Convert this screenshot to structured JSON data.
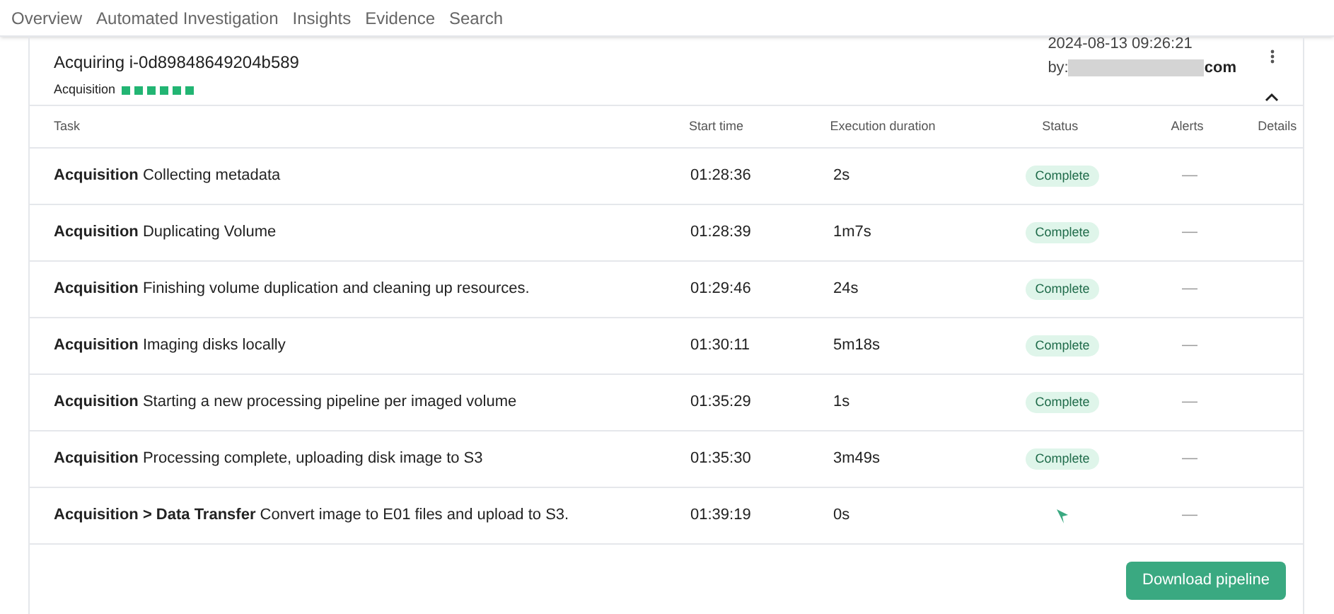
{
  "nav": {
    "tabs": [
      {
        "label": "Overview",
        "selected": false
      },
      {
        "label": "Automated Investigation",
        "selected": false
      },
      {
        "label": "Insights",
        "selected": false
      },
      {
        "label": "Evidence",
        "selected": false
      },
      {
        "label": "Search",
        "selected": false
      }
    ]
  },
  "header": {
    "title": "Acquiring i-0d89848649204b589",
    "stage": "Acquisition",
    "steps": [
      {
        "done": true
      },
      {
        "done": true
      },
      {
        "done": true
      },
      {
        "done": true
      },
      {
        "done": true
      },
      {
        "done": true
      }
    ],
    "timestamp": "2024-08-13 09:26:21",
    "by_label": "by:",
    "by_suffix": "com",
    "expanded": true
  },
  "table": {
    "columns": [
      "Task",
      "Start time",
      "Execution duration",
      "Status",
      "Alerts",
      "Details"
    ],
    "rows": [
      {
        "stage": "Acquisition",
        "task": "Collecting metadata",
        "start": "01:28:36",
        "duration": "2s",
        "status": {
          "kind": "complete",
          "label": "Complete"
        },
        "alerts": "—"
      },
      {
        "stage": "Acquisition",
        "task": "Duplicating Volume",
        "start": "01:28:39",
        "duration": "1m7s",
        "status": {
          "kind": "complete",
          "label": "Complete"
        },
        "alerts": "—"
      },
      {
        "stage": "Acquisition",
        "task": "Finishing volume duplication and cleaning up resources.",
        "start": "01:29:46",
        "duration": "24s",
        "status": {
          "kind": "complete",
          "label": "Complete"
        },
        "alerts": "—"
      },
      {
        "stage": "Acquisition",
        "task": "Imaging disks locally",
        "start": "01:30:11",
        "duration": "5m18s",
        "status": {
          "kind": "complete",
          "label": "Complete"
        },
        "alerts": "—"
      },
      {
        "stage": "Acquisition",
        "task": "Starting a new processing pipeline per imaged volume",
        "start": "01:35:29",
        "duration": "1s",
        "status": {
          "kind": "complete",
          "label": "Complete"
        },
        "alerts": "—"
      },
      {
        "stage": "Acquisition",
        "task": "Processing complete, uploading disk image to S3",
        "start": "01:35:30",
        "duration": "3m49s",
        "status": {
          "kind": "complete",
          "label": "Complete"
        },
        "alerts": "—"
      },
      {
        "stage": "Acquisition > Data Transfer",
        "task": "Convert image to E01 files and upload to S3.",
        "start": "01:39:19",
        "duration": "0s",
        "status": {
          "kind": "running"
        },
        "alerts": "—"
      }
    ]
  },
  "download_button": "Download pipeline"
}
